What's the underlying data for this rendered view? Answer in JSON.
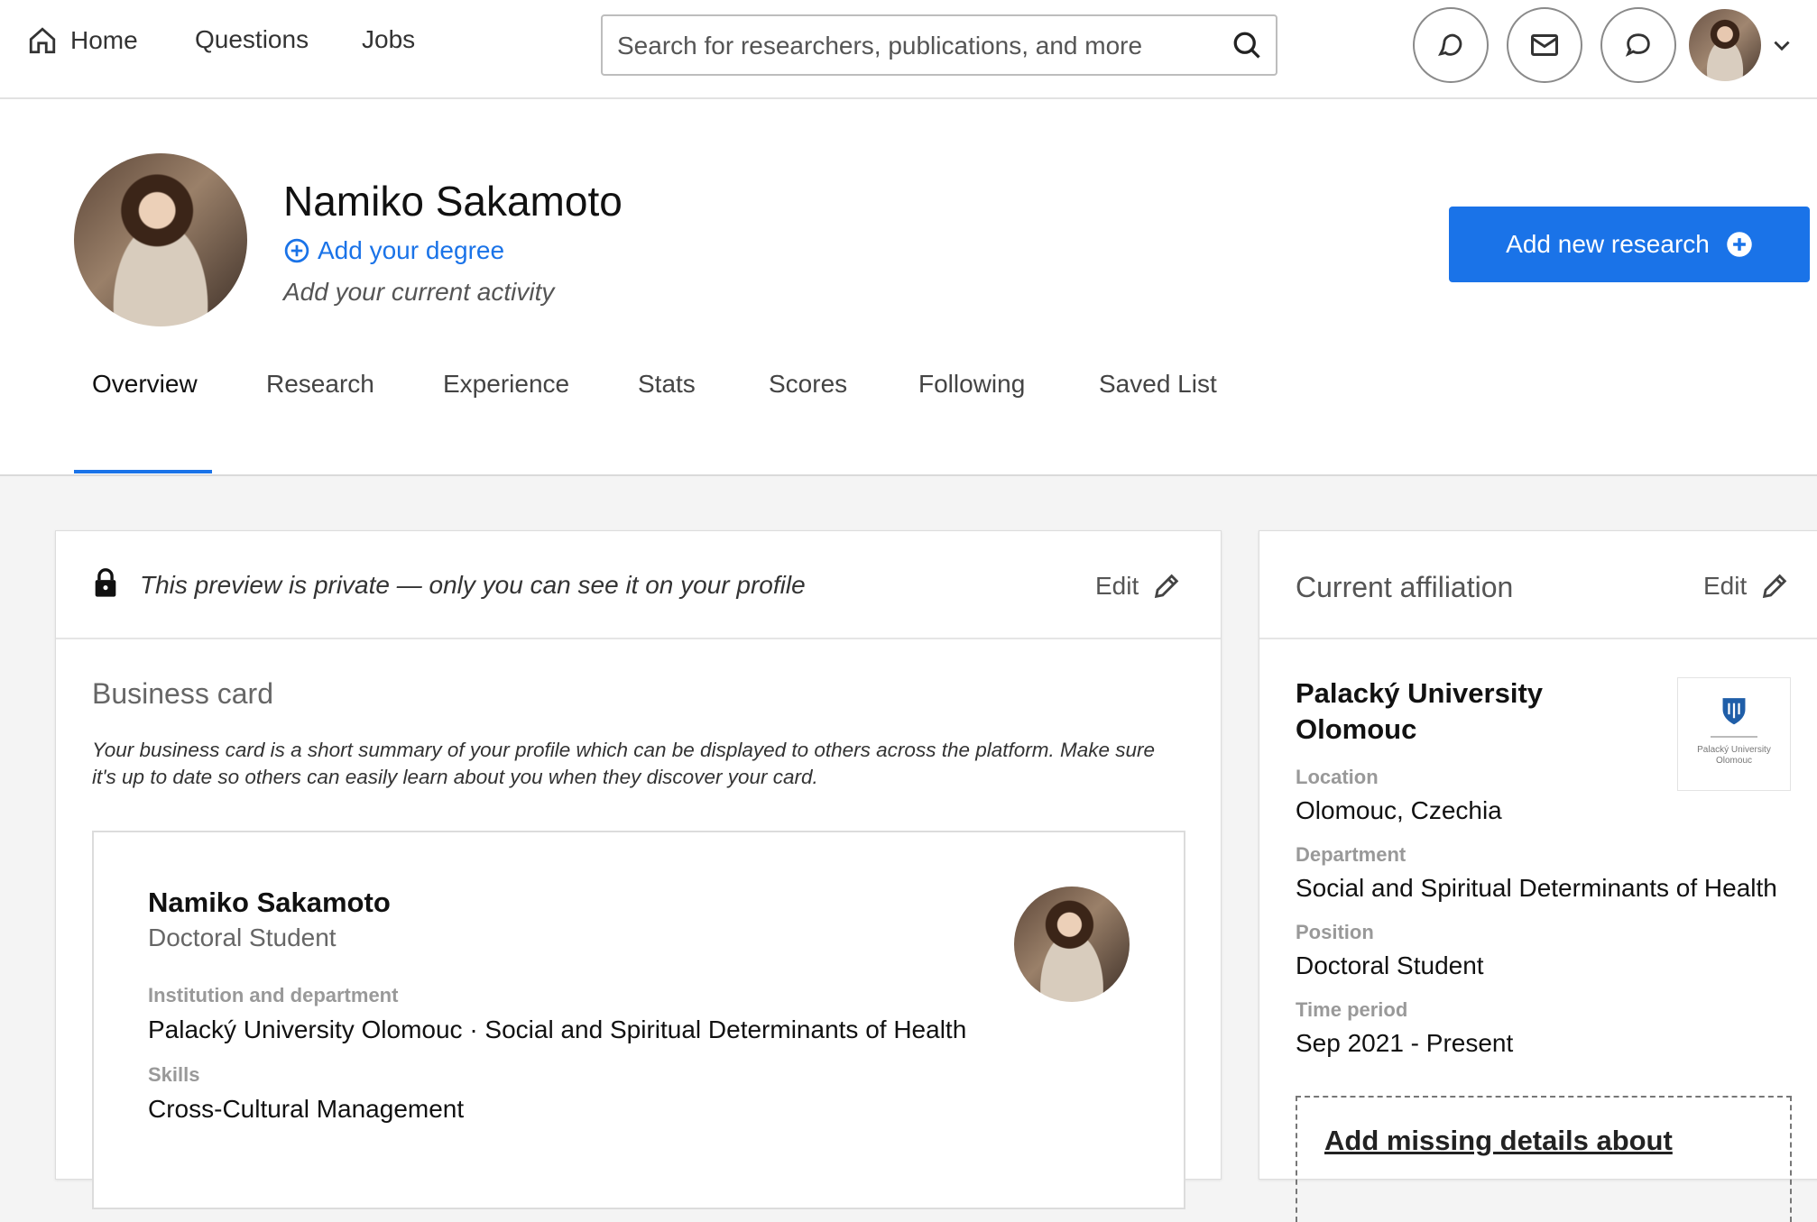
{
  "nav": {
    "home": "Home",
    "questions": "Questions",
    "jobs": "Jobs",
    "home_icon": "home-icon"
  },
  "search": {
    "placeholder": "Search for researchers, publications, and more",
    "icon": "search-icon"
  },
  "header_actions": [
    {
      "icon": "notifications-icon"
    },
    {
      "icon": "mail-icon"
    },
    {
      "icon": "chat-icon"
    }
  ],
  "profile": {
    "name": "Namiko Sakamoto",
    "add_degree": "Add your degree",
    "activity": "Add your current activity",
    "add_research": "Add new research"
  },
  "tabs": [
    {
      "label": "Overview",
      "active": true
    },
    {
      "label": "Research"
    },
    {
      "label": "Experience"
    },
    {
      "label": "Stats"
    },
    {
      "label": "Scores"
    },
    {
      "label": "Following"
    },
    {
      "label": "Saved List"
    }
  ],
  "left_card": {
    "private_notice": "This preview is private — only you can see it on your profile",
    "edit": "Edit",
    "section_title": "Business card",
    "section_desc": "Your business card is a short summary of your profile which can be displayed to others across the platform. Make sure it's up to date so others can easily learn about you when they discover your card.",
    "business_card": {
      "name": "Namiko Sakamoto",
      "role": "Doctoral Student",
      "institution_label": "Institution and department",
      "institution_value": "Palacký University Olomouc · Social and Spiritual Determinants of Health",
      "skills_label": "Skills",
      "skills_value": "Cross-Cultural Management"
    }
  },
  "right_card": {
    "title": "Current affiliation",
    "edit": "Edit",
    "institution": "Palacký University Olomouc",
    "logo_text": "Palacký University Olomouc",
    "location_label": "Location",
    "location": "Olomouc, Czechia",
    "department_label": "Department",
    "department": "Social and Spiritual Determinants of Health",
    "position_label": "Position",
    "position": "Doctoral Student",
    "period_label": "Time period",
    "period": "Sep 2021 - Present",
    "missing_details": "Add missing details about"
  },
  "colors": {
    "accent": "#1a73e8",
    "background": "#f4f4f4"
  }
}
